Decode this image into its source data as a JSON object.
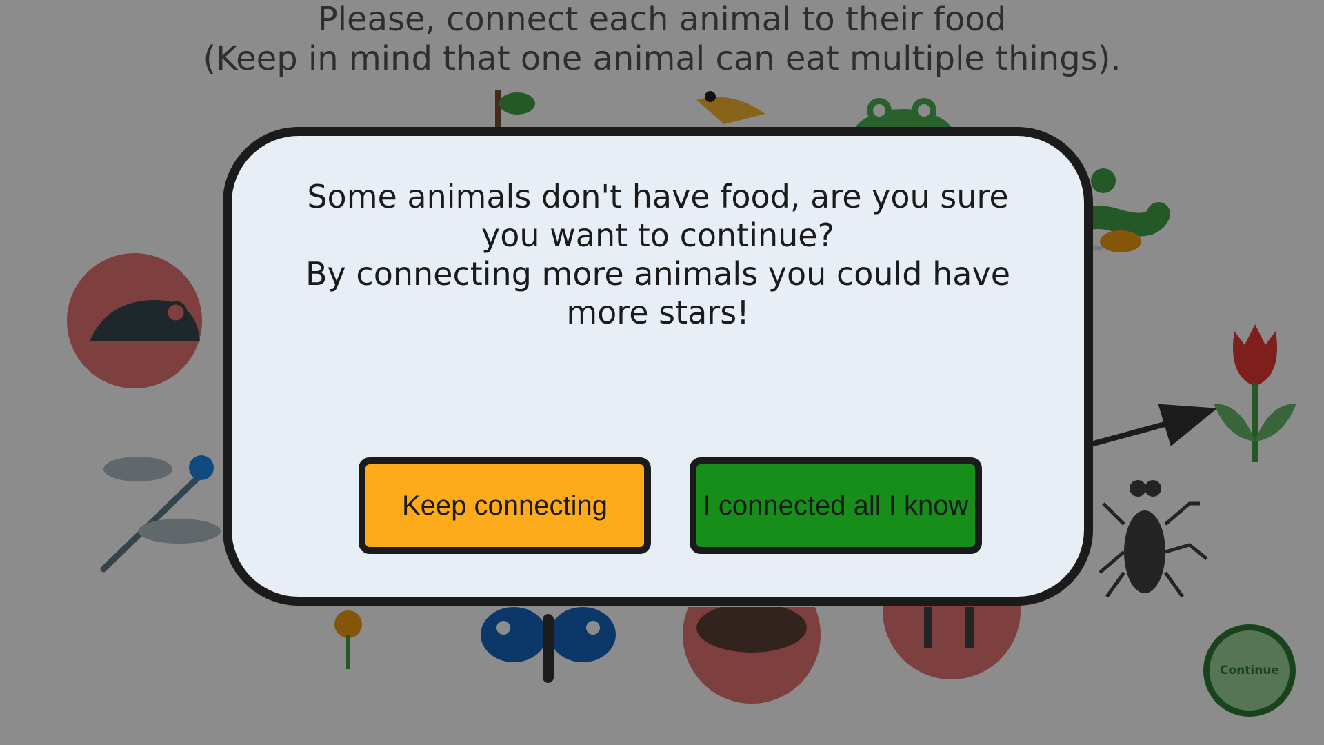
{
  "game": {
    "instructions_line1": "Please, connect each animal to their food",
    "instructions_line2": "(Keep in mind that one animal can eat multiple things).",
    "continue_label": "Continue",
    "icons": {
      "tree": "tree-icon",
      "eagle": "eagle-icon",
      "frog": "frog-icon",
      "snake": "snake-icon",
      "mouse": "mouse-icon",
      "tulip": "tulip-icon",
      "dragonfly": "dragonfly-icon",
      "fly": "fly-icon",
      "flower": "flower-icon",
      "butterfly": "butterfly-icon",
      "nest": "nest-icon",
      "goat": "goat-icon"
    }
  },
  "dialog": {
    "message_line1": "Some animals don't have food, are you sure you want to continue?",
    "message_line2": "By connecting more animals you could have more stars!",
    "keep_label": "Keep connecting",
    "done_label": "I connected all I know"
  },
  "colors": {
    "overlay": "#000000",
    "dialog_background": "#e8eef5",
    "dialog_border": "#1b1b1b",
    "keep_button": "#fdab1a",
    "done_button": "#178e1a"
  }
}
